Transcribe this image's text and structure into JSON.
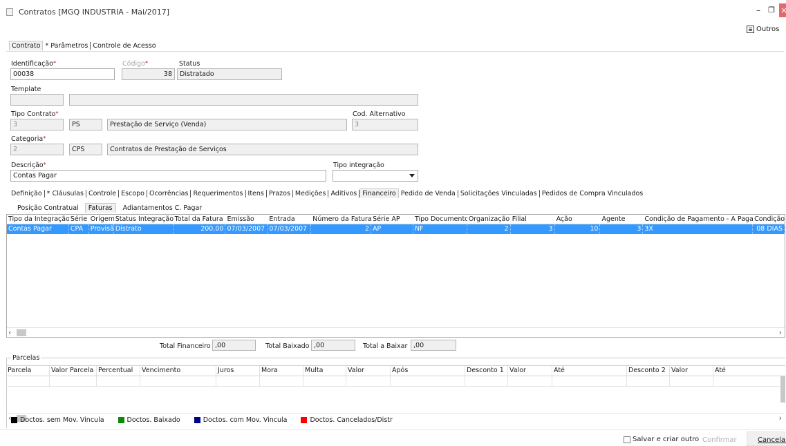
{
  "window": {
    "title": "Contratos [MGQ INDUSTRIA - Mai/2017]",
    "outros_label": "Outros"
  },
  "top_tabs": [
    "Contrato",
    "* Parâmetros",
    "Controle de Acesso"
  ],
  "form": {
    "identificacao": {
      "label": "Identificação",
      "value": "00038"
    },
    "codigo": {
      "label": "Código",
      "value": "38"
    },
    "status": {
      "label": "Status",
      "value": "Distratado"
    },
    "template": {
      "label": "Template",
      "code": "",
      "desc": ""
    },
    "tipo_contrato": {
      "label": "Tipo Contrato",
      "id": "3",
      "code": "PS",
      "desc": "Prestação de Serviço (Venda)"
    },
    "cod_alternativo": {
      "label": "Cod. Alternativo",
      "value": "3"
    },
    "categoria": {
      "label": "Categoria",
      "id": "2",
      "code": "CPS",
      "desc": "Contratos de Prestação de Serviços"
    },
    "descricao": {
      "label": "Descrição",
      "value": "Contas Pagar"
    },
    "tipo_integracao": {
      "label": "Tipo integração",
      "value": ""
    }
  },
  "section_tabs": [
    "Definição",
    "* Cláusulas",
    "Controle",
    "Escopo",
    "Ocorrências",
    "Requerimentos",
    "Itens",
    "Prazos",
    "Medições",
    "Aditivos",
    "Financeiro",
    "Pedido de Venda",
    "Solicitações Vinculadas",
    "Pedidos de Compra Vinculados"
  ],
  "sub_tabs": [
    "Posição Contratual",
    "Faturas",
    "Adiantamentos C. Pagar"
  ],
  "faturas_grid": {
    "columns": [
      "Tipo da Integração",
      "Série",
      "Origem",
      "Status Integração",
      "Total da Fatura",
      "Emissão",
      "Entrada",
      "Número da Fatura",
      "Série AP",
      "Tipo Documento",
      "Organização",
      "Filial",
      "Ação",
      "Agente",
      "Condição de Pagamento - A Pagar",
      "Condição"
    ],
    "rows": [
      [
        "Contas Pagar",
        "CPA",
        "Provisã",
        "Distrato",
        "200,00",
        "07/03/2007",
        "07/03/2007",
        "2",
        "AP",
        "NF",
        "2",
        "3",
        "10",
        "3",
        "3X",
        "08 DIAS"
      ]
    ]
  },
  "totals": {
    "financeiro": {
      "label": "Total Financeiro",
      "value": ",00"
    },
    "baixado": {
      "label": "Total Baixado",
      "value": ",00"
    },
    "a_baixar": {
      "label": "Total a Baixar",
      "value": ",00"
    }
  },
  "parcelas": {
    "title": "Parcelas",
    "columns": [
      "Parcela",
      "Valor Parcela",
      "Percentual",
      "Vencimento",
      "Juros",
      "Mora",
      "Multa",
      "Valor",
      "Após",
      "Desconto 1",
      "Valor",
      "Até",
      "Desconto 2",
      "Valor",
      "Até"
    ]
  },
  "legend": [
    {
      "label": "Doctos. sem Mov. Vincula",
      "color": "#000000"
    },
    {
      "label": "Doctos. Baixado",
      "color": "#0a8a0a"
    },
    {
      "label": "Doctos. com Mov. Vincula",
      "color": "#00008b"
    },
    {
      "label": "Doctos. Cancelados/Distr",
      "color": "#ff0000"
    }
  ],
  "footer": {
    "salvar_label": "Salvar e criar outro",
    "confirmar_label": "Confirmar",
    "cancelar_label": "Cancelar"
  },
  "colors": {
    "selection": "#3399ff",
    "close": "#e06b6b"
  }
}
